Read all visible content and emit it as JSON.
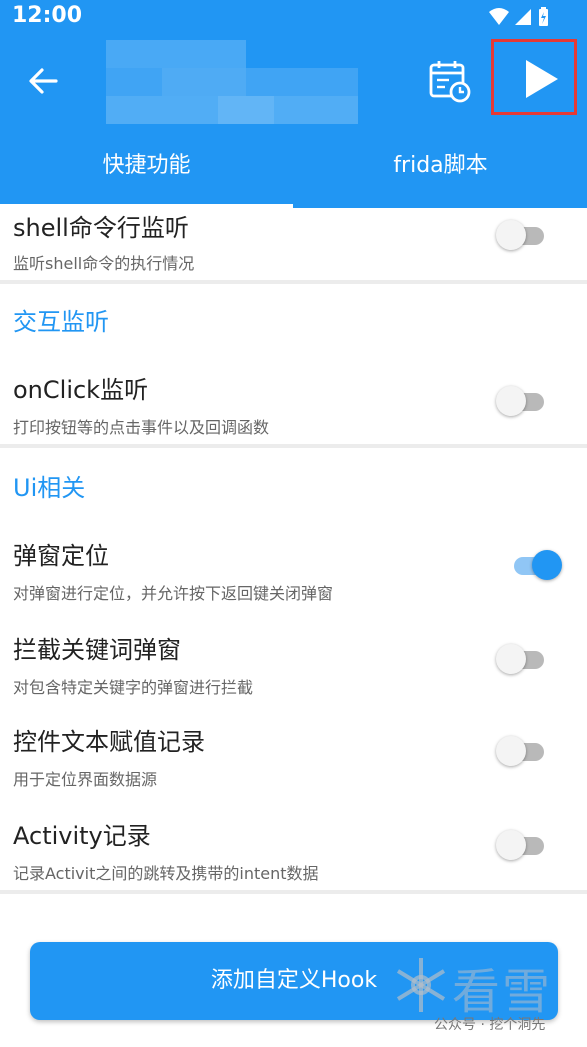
{
  "status": {
    "time": "12:00"
  },
  "appbar": {
    "back_icon": "arrow-back-icon",
    "calendar_icon": "calendar-clock-icon",
    "play_icon": "play-icon"
  },
  "tabs": [
    {
      "label": "快捷功能",
      "selected": true
    },
    {
      "label": "frida脚本",
      "selected": false
    }
  ],
  "items": {
    "shell": {
      "title": "shell命令行监听",
      "sub": "监听shell命令的执行情况",
      "on": false
    },
    "interaction_section": "交互监听",
    "onclick": {
      "title": "onClick监听",
      "sub": "打印按钮等的点击事件以及回调函数",
      "on": false
    },
    "ui_section": "Ui相关",
    "dialog_pos": {
      "title": "弹窗定位",
      "sub": "对弹窗进行定位，并允许按下返回键关闭弹窗",
      "on": true
    },
    "block_kw": {
      "title": "拦截关键词弹窗",
      "sub": "对包含特定关键字的弹窗进行拦截",
      "on": false
    },
    "text_record": {
      "title": "控件文本赋值记录",
      "sub": "用于定位界面数据源",
      "on": false
    },
    "activity": {
      "title": "Activity记录",
      "sub": "记录Activit之间的跳转及携带的intent数据",
      "on": false
    }
  },
  "add_button": "添加自定义Hook",
  "watermark": {
    "main": "看雪",
    "sub": "公众号 · 挖个洞先"
  },
  "colors": {
    "primary": "#2196F3",
    "highlight_border": "#e53935"
  }
}
